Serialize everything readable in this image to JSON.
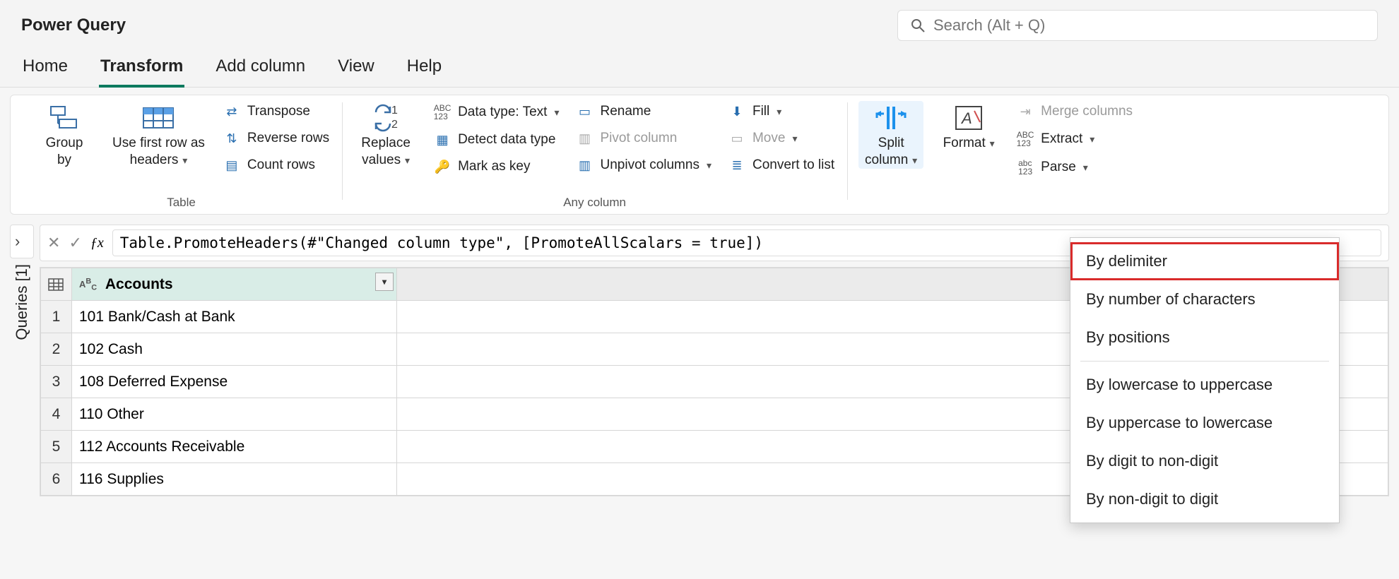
{
  "header": {
    "title": "Power Query",
    "search_placeholder": "Search (Alt + Q)"
  },
  "tabs": [
    "Home",
    "Transform",
    "Add column",
    "View",
    "Help"
  ],
  "active_tab": 1,
  "ribbon": {
    "table": {
      "label": "Table",
      "group_by": "Group\nby",
      "use_first_row": "Use first row as\nheaders",
      "transpose": "Transpose",
      "reverse_rows": "Reverse rows",
      "count_rows": "Count rows"
    },
    "anycol": {
      "label": "Any column",
      "replace_values": "Replace\nvalues",
      "data_type": "Data type: Text",
      "detect": "Detect data type",
      "mark_key": "Mark as key",
      "rename": "Rename",
      "pivot": "Pivot column",
      "unpivot": "Unpivot columns",
      "fill": "Fill",
      "move": "Move",
      "convert": "Convert to list"
    },
    "textcol": {
      "split": "Split\ncolumn",
      "format": "Format",
      "merge": "Merge columns",
      "extract": "Extract",
      "parse": "Parse"
    }
  },
  "split_menu": [
    "By delimiter",
    "By number of characters",
    "By positions",
    "By lowercase to uppercase",
    "By uppercase to lowercase",
    "By digit to non-digit",
    "By non-digit to digit"
  ],
  "queries_label": "Queries [1]",
  "formula": "Table.PromoteHeaders(#\"Changed column type\", [PromoteAllScalars = true])",
  "column_name": "Accounts",
  "rows": [
    "101 Bank/Cash at Bank",
    "102 Cash",
    "108 Deferred Expense",
    "110 Other",
    "112 Accounts Receivable",
    "116 Supplies"
  ]
}
